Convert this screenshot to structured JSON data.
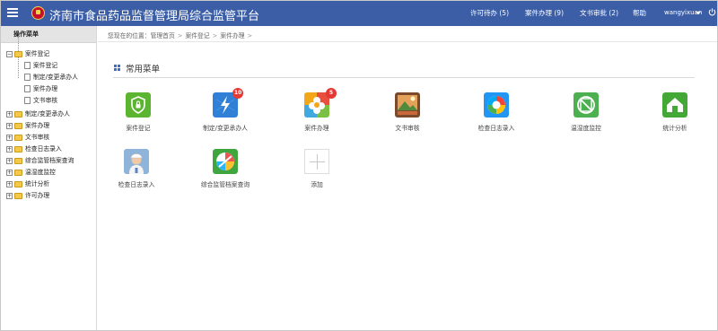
{
  "header": {
    "title": "济南市食品药品监督管理局综合监管平台",
    "nav": [
      {
        "label": "许可待办 (5)"
      },
      {
        "label": "案件办理 (9)"
      },
      {
        "label": "文书审批 (2)"
      },
      {
        "label": "帮助"
      }
    ],
    "username": "wangyixuan",
    "brand_color": "#3b5ea7"
  },
  "sidebar": {
    "heading": "操作菜单",
    "tree": [
      {
        "label": "案件登记",
        "expanded": true,
        "sign": "−",
        "children": [
          {
            "label": "案件登记"
          },
          {
            "label": "制定/变更承办人"
          },
          {
            "label": "案件办理"
          },
          {
            "label": "文书审核"
          }
        ]
      },
      {
        "label": "制定/变更承办人",
        "sign": "+"
      },
      {
        "label": "案件办理",
        "sign": "+"
      },
      {
        "label": "文书审核",
        "sign": "+"
      },
      {
        "label": "检查日志录入",
        "sign": "+"
      },
      {
        "label": "综合监管档案查询",
        "sign": "+"
      },
      {
        "label": "温湿度监控",
        "sign": "+"
      },
      {
        "label": "统计分析",
        "sign": "+"
      },
      {
        "label": "许可办理",
        "sign": "+"
      }
    ]
  },
  "breadcrumb": {
    "prefix": "您现在的位置：",
    "items": [
      "管理首页",
      "案件登记",
      "案件办理"
    ],
    "separator": ">"
  },
  "section": {
    "title": "常用菜单"
  },
  "tiles": [
    {
      "label": "案件登记",
      "icon": "shield-icon",
      "color": "#5cb531"
    },
    {
      "label": "制定/变更承办人",
      "icon": "lightning-icon",
      "color": "#2f80d6",
      "badge": "10"
    },
    {
      "label": "案件办理",
      "icon": "flower-icon",
      "color": "#f2a71b",
      "badge": "5"
    },
    {
      "label": "文书审核",
      "icon": "picture-icon",
      "color": "#c9683a"
    },
    {
      "label": "检查日志录入",
      "icon": "swirl-icon",
      "color": "#2196f3"
    },
    {
      "label": "温湿度监控",
      "icon": "no-sign-icon",
      "color": "#4caf50"
    },
    {
      "label": "统计分析",
      "icon": "home-icon",
      "color": "#43a836"
    },
    {
      "label": "检查日志录入",
      "icon": "inspector-icon",
      "color": "#8fb4d9"
    },
    {
      "label": "综合监管档案查询",
      "icon": "ball-icon",
      "color": "#3fa63f"
    },
    {
      "label": "添加",
      "icon": "plus-icon",
      "color": "#c8c8c8"
    }
  ]
}
